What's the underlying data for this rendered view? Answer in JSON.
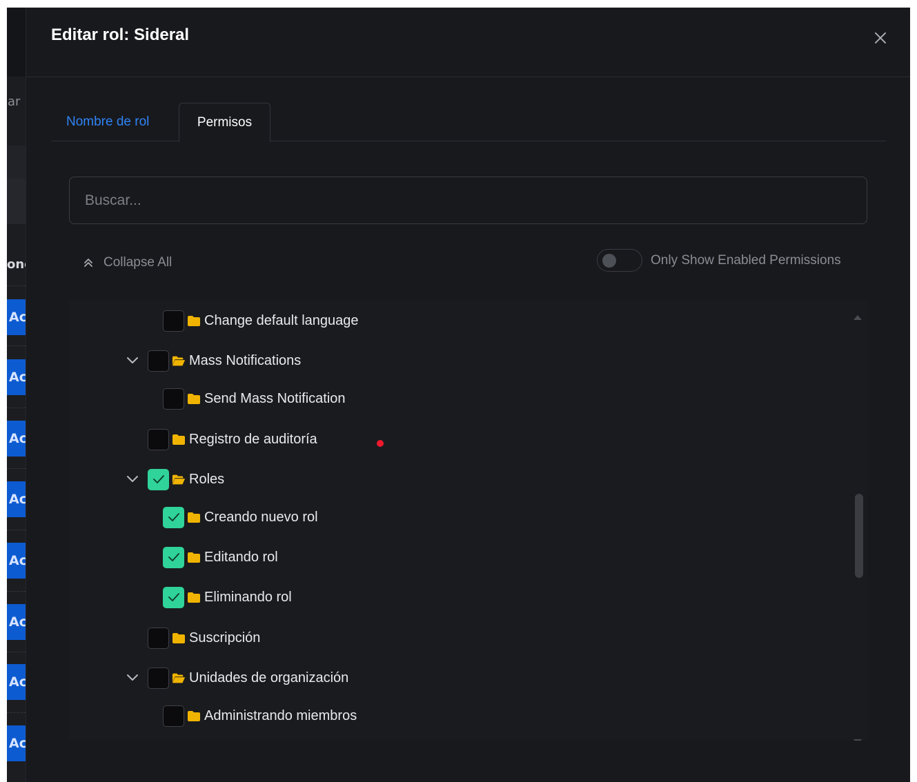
{
  "modal": {
    "title": "Editar rol: Sideral",
    "close_icon": "close-icon"
  },
  "tabs": [
    {
      "label": "Nombre de rol",
      "active": false
    },
    {
      "label": "Permisos",
      "active": true
    }
  ],
  "search": {
    "placeholder": "Buscar...",
    "value": ""
  },
  "controls": {
    "collapse_all_label": "Collapse All",
    "only_enabled_label": "Only Show Enabled Permissions",
    "only_enabled_on": false
  },
  "background": {
    "partial_texts": [
      "ar",
      "one"
    ],
    "band_label": "Ac"
  },
  "tree": [
    {
      "label": "Change default language",
      "level": 2,
      "checked": false,
      "expandable": false,
      "folder": "folder-icon"
    },
    {
      "label": "Mass Notifications",
      "level": 1,
      "checked": false,
      "expandable": true,
      "folder": "folder-open-icon"
    },
    {
      "label": "Send Mass Notification",
      "level": 2,
      "checked": false,
      "expandable": false,
      "folder": "folder-icon"
    },
    {
      "label": "Registro de auditoría",
      "level": 1,
      "checked": false,
      "expandable": false,
      "folder": "folder-icon"
    },
    {
      "label": "Roles",
      "level": 1,
      "checked": true,
      "expandable": true,
      "folder": "folder-open-icon"
    },
    {
      "label": "Creando nuevo rol",
      "level": 2,
      "checked": true,
      "expandable": false,
      "folder": "folder-icon"
    },
    {
      "label": "Editando rol",
      "level": 2,
      "checked": true,
      "expandable": false,
      "folder": "folder-icon"
    },
    {
      "label": "Eliminando rol",
      "level": 2,
      "checked": true,
      "expandable": false,
      "folder": "folder-icon"
    },
    {
      "label": "Suscripción",
      "level": 1,
      "checked": false,
      "expandable": false,
      "folder": "folder-icon"
    },
    {
      "label": "Unidades de organización",
      "level": 1,
      "checked": false,
      "expandable": true,
      "folder": "folder-open-icon"
    },
    {
      "label": "Administrando miembros",
      "level": 2,
      "checked": false,
      "expandable": false,
      "folder": "folder-icon"
    }
  ],
  "colors": {
    "accent_blue": "#2f83f5",
    "check_green": "#30d39a",
    "folder_yellow": "#f0b400",
    "background": "#18191d",
    "indicator_red": "#f0192d"
  }
}
